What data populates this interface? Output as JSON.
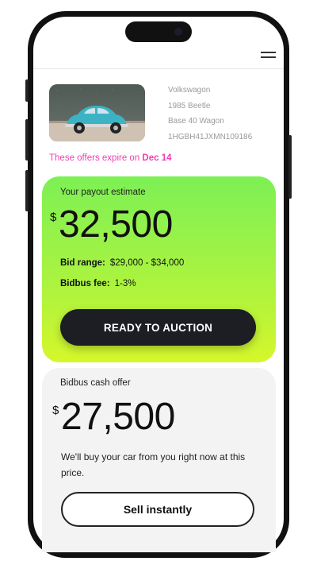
{
  "car": {
    "make": "Volkswagon",
    "model": "1985 Beetle",
    "trim": "Base 40 Wagon",
    "vin": "1HGBH41JXMN109186"
  },
  "offers": {
    "expire_prefix": "These offers expire on ",
    "expire_date": "Dec 14"
  },
  "payout": {
    "label": "Your payout estimate",
    "currency": "$",
    "amount": "32,500",
    "bid_range_label": "Bid range:",
    "bid_range_value": "$29,000 - $34,000",
    "fee_label": "Bidbus fee:",
    "fee_value": "1-3%",
    "button_label": "READY TO AUCTION"
  },
  "cash_offer": {
    "label": "Bidbus cash offer",
    "currency": "$",
    "amount": "27,500",
    "description": "We'll buy your car from you right now at this price.",
    "button_label": "Sell instantly"
  },
  "icons": {
    "menu": "hamburger-menu-icon",
    "car_photo": "car-photo"
  },
  "colors": {
    "accent_pink": "#f03eb2",
    "card_green_top": "#7cf055",
    "card_green_bottom": "#d6f62a",
    "button_dark": "#1d1d24",
    "cash_card_bg": "#f3f3f3"
  }
}
